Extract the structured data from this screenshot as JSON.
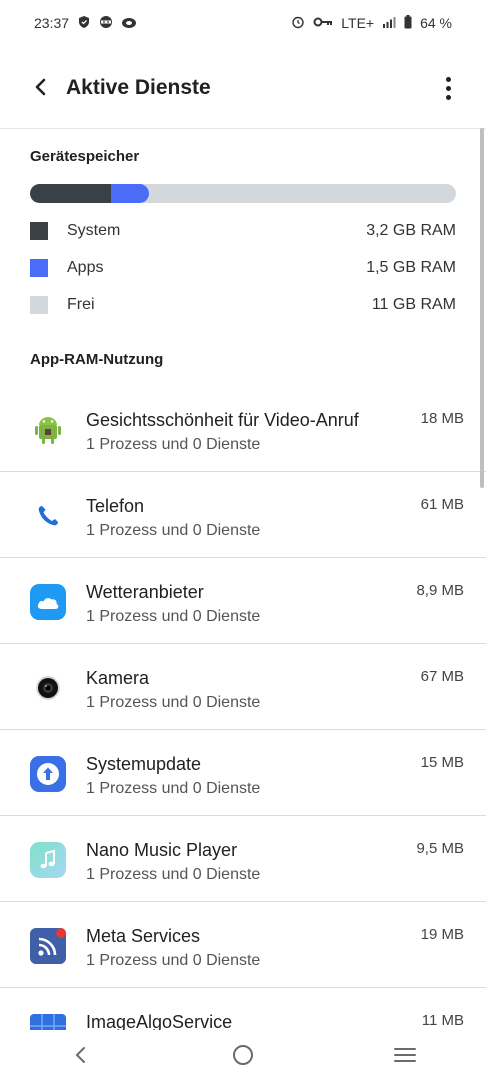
{
  "status_bar": {
    "time": "23:37",
    "network": "LTE+",
    "battery": "64 %"
  },
  "header": {
    "title": "Aktive Dienste"
  },
  "storage": {
    "title": "Gerätespeicher",
    "usage": [
      {
        "label": "System",
        "value": "3,2 GB RAM",
        "color": "#3a4146",
        "fraction": 0.19
      },
      {
        "label": "Apps",
        "value": "1,5 GB RAM",
        "color": "#4a6cf7",
        "fraction": 0.09
      },
      {
        "label": "Frei",
        "value": "11 GB RAM",
        "color": "#d3d8dd",
        "fraction": 0.72
      }
    ]
  },
  "app_ram": {
    "title": "App-RAM-Nutzung",
    "apps": [
      {
        "name": "Gesichtsschönheit für Video-Anruf",
        "sub": "1 Prozess und 0 Dienste",
        "size": "18 MB",
        "icon": "android-icon"
      },
      {
        "name": "Telefon",
        "sub": "1 Prozess und 0 Dienste",
        "size": "61 MB",
        "icon": "phone-icon"
      },
      {
        "name": "Wetteranbieter",
        "sub": "1 Prozess und 0 Dienste",
        "size": "8,9 MB",
        "icon": "weather-icon"
      },
      {
        "name": "Kamera",
        "sub": "1 Prozess und 0 Dienste",
        "size": "67 MB",
        "icon": "camera-icon"
      },
      {
        "name": "Systemupdate",
        "sub": "1 Prozess und 0 Dienste",
        "size": "15 MB",
        "icon": "system-update-icon"
      },
      {
        "name": "Nano Music Player",
        "sub": "1 Prozess und 0 Dienste",
        "size": "9,5 MB",
        "icon": "music-icon"
      },
      {
        "name": "Meta Services",
        "sub": "1 Prozess und 0 Dienste",
        "size": "19 MB",
        "icon": "meta-services-icon"
      },
      {
        "name": "ImageAlgoService",
        "sub": "",
        "size": "11 MB",
        "icon": "image-algo-icon"
      }
    ]
  }
}
